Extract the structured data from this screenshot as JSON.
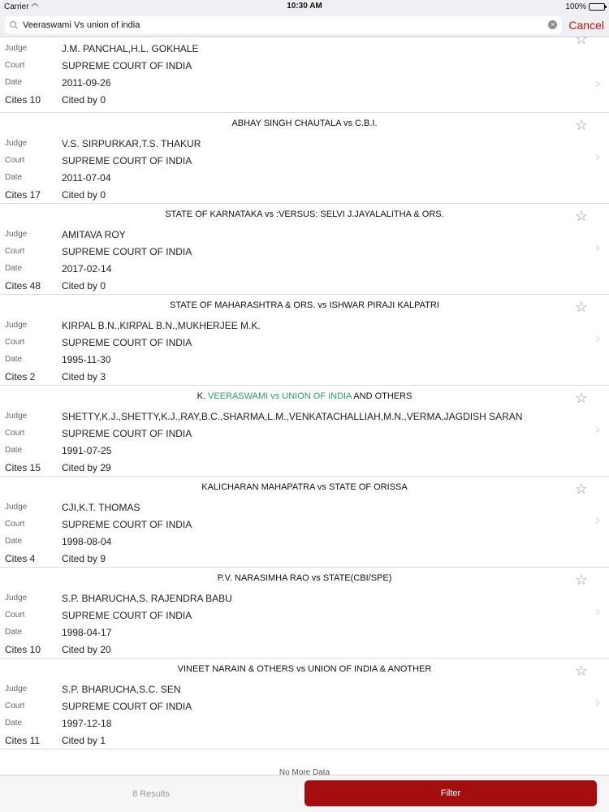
{
  "status": {
    "carrier": "Carrier",
    "time": "10:30 AM",
    "battery": "100%",
    "battery_level": 1.0
  },
  "search": {
    "query": "Veeraswami Vs union of india",
    "cancel_label": "Cancel"
  },
  "labels": {
    "judge": "Judge",
    "court": "Court",
    "date": "Date",
    "cites_prefix": "Cites",
    "cited_by_prefix": "Cited by"
  },
  "cases": [
    {
      "title": "",
      "judge": "J.M. PANCHAL,H.L. GOKHALE",
      "court": "SUPREME COURT OF INDIA",
      "date": "2011-09-26",
      "cites": "Cites 10",
      "cited_by": "Cited by 0"
    },
    {
      "title": "ABHAY SINGH CHAUTALA vs C.B.I.",
      "judge": "V.S. SIRPURKAR,T.S. THAKUR",
      "court": "SUPREME COURT OF INDIA",
      "date": "2011-07-04",
      "cites": "Cites 17",
      "cited_by": "Cited by 0"
    },
    {
      "title": "STATE OF KARNATAKA vs :VERSUS: SELVI J.JAYALALITHA & ORS.",
      "judge": "AMITAVA ROY",
      "court": "SUPREME COURT OF INDIA",
      "date": "2017-02-14",
      "cites": "Cites 48",
      "cited_by": "Cited by 0"
    },
    {
      "title": "STATE OF MAHARASHTRA & ORS. vs ISHWAR PIRAJI KALPATRI",
      "judge": "KIRPAL B.N.,KIRPAL B.N.,MUKHERJEE M.K.",
      "court": "SUPREME COURT OF INDIA",
      "date": "1995-11-30",
      "cites": "Cites 2",
      "cited_by": "Cited by 3"
    },
    {
      "title_prefix": "K. ",
      "title_highlight": "VEERASWAMI vs UNION OF INDIA",
      "title_suffix": " AND OTHERS",
      "judge": "SHETTY,K.J.,SHETTY,K.J.,RAY,B.C.,SHARMA,L.M.,VENKATACHALLIAH,M.N.,VERMA,JAGDISH SARAN",
      "court": "SUPREME COURT OF INDIA",
      "date": "1991-07-25",
      "cites": "Cites 15",
      "cited_by": "Cited by 29"
    },
    {
      "title": "KALICHARAN MAHAPATRA vs STATE OF ORISSA",
      "judge": "CJI,K.T. THOMAS",
      "court": "SUPREME COURT OF INDIA",
      "date": "1998-08-04",
      "cites": "Cites 4",
      "cited_by": "Cited by 9"
    },
    {
      "title": "P.V. NARASIMHA RAO vs STATE(CBI/SPE)",
      "judge": "S.P. BHARUCHA,S. RAJENDRA BABU",
      "court": "SUPREME COURT OF INDIA",
      "date": "1998-04-17",
      "cites": "Cites 10",
      "cited_by": "Cited by 20"
    },
    {
      "title": "VINEET NARAIN & OTHERS vs UNION OF INDIA & ANOTHER",
      "judge": "S.P. BHARUCHA,S.C. SEN",
      "court": "SUPREME COURT OF INDIA",
      "date": "1997-12-18",
      "cites": "Cites 11",
      "cited_by": "Cited by 1"
    }
  ],
  "footer": {
    "no_more": "No More Data",
    "results": "8 Results",
    "filter_label": "Filter"
  },
  "colors": {
    "accent": "#a50e0e",
    "highlight": "#2a9a6b"
  },
  "icons": {
    "star": "star-icon",
    "chevron": "chevron-right-icon",
    "search": "search-icon",
    "clear": "clear-icon"
  }
}
